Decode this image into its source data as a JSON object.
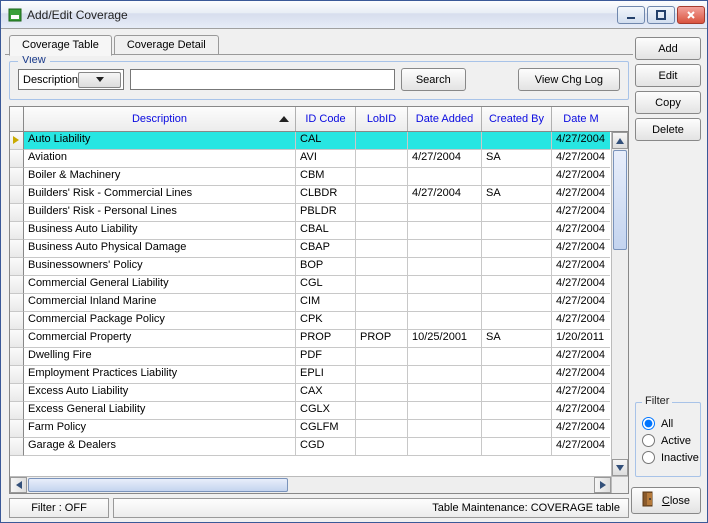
{
  "window": {
    "title": "Add/Edit Coverage"
  },
  "tabs": {
    "coverage_table": "Coverage Table",
    "coverage_detail": "Coverage Detail"
  },
  "view": {
    "legend": "View",
    "combo_value": "Description",
    "search_value": "",
    "search_btn": "Search",
    "view_chg_log_btn": "View Chg Log"
  },
  "columns": {
    "desc": "Description",
    "id": "ID Code",
    "lob": "LobID",
    "date_added": "Date Added",
    "created_by": "Created By",
    "date_m": "Date M"
  },
  "rows": [
    {
      "desc": "Auto Liability",
      "id": "CAL",
      "lob": "",
      "date_added": "",
      "created_by": "",
      "date_m": "4/27/2004",
      "sel": true
    },
    {
      "desc": "Aviation",
      "id": "AVI",
      "lob": "",
      "date_added": "4/27/2004",
      "created_by": "SA",
      "date_m": "4/27/2004"
    },
    {
      "desc": "Boiler & Machinery",
      "id": "CBM",
      "lob": "",
      "date_added": "",
      "created_by": "",
      "date_m": "4/27/2004"
    },
    {
      "desc": "Builders' Risk - Commercial Lines",
      "id": "CLBDR",
      "lob": "",
      "date_added": "4/27/2004",
      "created_by": "SA",
      "date_m": "4/27/2004"
    },
    {
      "desc": "Builders' Risk - Personal Lines",
      "id": "PBLDR",
      "lob": "",
      "date_added": "",
      "created_by": "",
      "date_m": "4/27/2004"
    },
    {
      "desc": "Business Auto Liability",
      "id": "CBAL",
      "lob": "",
      "date_added": "",
      "created_by": "",
      "date_m": "4/27/2004"
    },
    {
      "desc": "Business Auto Physical Damage",
      "id": "CBAP",
      "lob": "",
      "date_added": "",
      "created_by": "",
      "date_m": "4/27/2004"
    },
    {
      "desc": "Businessowners' Policy",
      "id": "BOP",
      "lob": "",
      "date_added": "",
      "created_by": "",
      "date_m": "4/27/2004"
    },
    {
      "desc": "Commercial General Liability",
      "id": "CGL",
      "lob": "",
      "date_added": "",
      "created_by": "",
      "date_m": "4/27/2004"
    },
    {
      "desc": "Commercial Inland Marine",
      "id": "CIM",
      "lob": "",
      "date_added": "",
      "created_by": "",
      "date_m": "4/27/2004"
    },
    {
      "desc": "Commercial Package Policy",
      "id": "CPK",
      "lob": "",
      "date_added": "",
      "created_by": "",
      "date_m": "4/27/2004"
    },
    {
      "desc": "Commercial Property",
      "id": "PROP",
      "lob": "PROP",
      "date_added": "10/25/2001",
      "created_by": "SA",
      "date_m": "1/20/2011"
    },
    {
      "desc": "Dwelling Fire",
      "id": "PDF",
      "lob": "",
      "date_added": "",
      "created_by": "",
      "date_m": "4/27/2004"
    },
    {
      "desc": "Employment Practices Liability",
      "id": "EPLI",
      "lob": "",
      "date_added": "",
      "created_by": "",
      "date_m": "4/27/2004"
    },
    {
      "desc": "Excess Auto Liability",
      "id": "CAX",
      "lob": "",
      "date_added": "",
      "created_by": "",
      "date_m": "4/27/2004"
    },
    {
      "desc": "Excess General Liability",
      "id": "CGLX",
      "lob": "",
      "date_added": "",
      "created_by": "",
      "date_m": "4/27/2004"
    },
    {
      "desc": "Farm Policy",
      "id": "CGLFM",
      "lob": "",
      "date_added": "",
      "created_by": "",
      "date_m": "4/27/2004"
    },
    {
      "desc": "Garage & Dealers",
      "id": "CGD",
      "lob": "",
      "date_added": "",
      "created_by": "",
      "date_m": "4/27/2004"
    }
  ],
  "status": {
    "filter": "Filter : OFF",
    "maint": "Table Maintenance:  COVERAGE table"
  },
  "side": {
    "add": "Add",
    "edit": "Edit",
    "copy": "Copy",
    "delete": "Delete"
  },
  "filter": {
    "legend": "Filter",
    "all": "All",
    "active": "Active",
    "inactive": "Inactive",
    "selected": "all"
  },
  "close": {
    "label_rest": "lose",
    "label_u": "C"
  }
}
